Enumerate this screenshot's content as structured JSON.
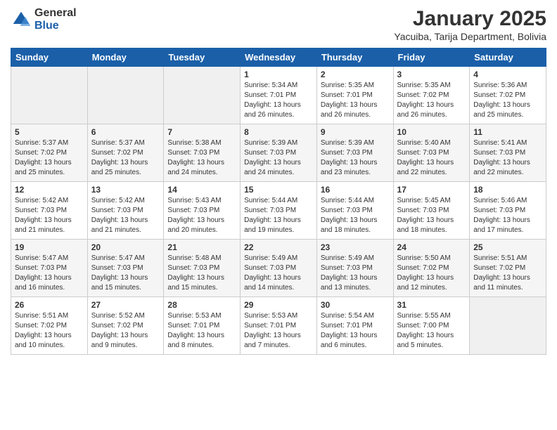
{
  "logo": {
    "general": "General",
    "blue": "Blue"
  },
  "title": "January 2025",
  "subtitle": "Yacuiba, Tarija Department, Bolivia",
  "days_of_week": [
    "Sunday",
    "Monday",
    "Tuesday",
    "Wednesday",
    "Thursday",
    "Friday",
    "Saturday"
  ],
  "weeks": [
    [
      {
        "day": "",
        "info": ""
      },
      {
        "day": "",
        "info": ""
      },
      {
        "day": "",
        "info": ""
      },
      {
        "day": "1",
        "info": "Sunrise: 5:34 AM\nSunset: 7:01 PM\nDaylight: 13 hours\nand 26 minutes."
      },
      {
        "day": "2",
        "info": "Sunrise: 5:35 AM\nSunset: 7:01 PM\nDaylight: 13 hours\nand 26 minutes."
      },
      {
        "day": "3",
        "info": "Sunrise: 5:35 AM\nSunset: 7:02 PM\nDaylight: 13 hours\nand 26 minutes."
      },
      {
        "day": "4",
        "info": "Sunrise: 5:36 AM\nSunset: 7:02 PM\nDaylight: 13 hours\nand 25 minutes."
      }
    ],
    [
      {
        "day": "5",
        "info": "Sunrise: 5:37 AM\nSunset: 7:02 PM\nDaylight: 13 hours\nand 25 minutes."
      },
      {
        "day": "6",
        "info": "Sunrise: 5:37 AM\nSunset: 7:02 PM\nDaylight: 13 hours\nand 25 minutes."
      },
      {
        "day": "7",
        "info": "Sunrise: 5:38 AM\nSunset: 7:03 PM\nDaylight: 13 hours\nand 24 minutes."
      },
      {
        "day": "8",
        "info": "Sunrise: 5:39 AM\nSunset: 7:03 PM\nDaylight: 13 hours\nand 24 minutes."
      },
      {
        "day": "9",
        "info": "Sunrise: 5:39 AM\nSunset: 7:03 PM\nDaylight: 13 hours\nand 23 minutes."
      },
      {
        "day": "10",
        "info": "Sunrise: 5:40 AM\nSunset: 7:03 PM\nDaylight: 13 hours\nand 22 minutes."
      },
      {
        "day": "11",
        "info": "Sunrise: 5:41 AM\nSunset: 7:03 PM\nDaylight: 13 hours\nand 22 minutes."
      }
    ],
    [
      {
        "day": "12",
        "info": "Sunrise: 5:42 AM\nSunset: 7:03 PM\nDaylight: 13 hours\nand 21 minutes."
      },
      {
        "day": "13",
        "info": "Sunrise: 5:42 AM\nSunset: 7:03 PM\nDaylight: 13 hours\nand 21 minutes."
      },
      {
        "day": "14",
        "info": "Sunrise: 5:43 AM\nSunset: 7:03 PM\nDaylight: 13 hours\nand 20 minutes."
      },
      {
        "day": "15",
        "info": "Sunrise: 5:44 AM\nSunset: 7:03 PM\nDaylight: 13 hours\nand 19 minutes."
      },
      {
        "day": "16",
        "info": "Sunrise: 5:44 AM\nSunset: 7:03 PM\nDaylight: 13 hours\nand 18 minutes."
      },
      {
        "day": "17",
        "info": "Sunrise: 5:45 AM\nSunset: 7:03 PM\nDaylight: 13 hours\nand 18 minutes."
      },
      {
        "day": "18",
        "info": "Sunrise: 5:46 AM\nSunset: 7:03 PM\nDaylight: 13 hours\nand 17 minutes."
      }
    ],
    [
      {
        "day": "19",
        "info": "Sunrise: 5:47 AM\nSunset: 7:03 PM\nDaylight: 13 hours\nand 16 minutes."
      },
      {
        "day": "20",
        "info": "Sunrise: 5:47 AM\nSunset: 7:03 PM\nDaylight: 13 hours\nand 15 minutes."
      },
      {
        "day": "21",
        "info": "Sunrise: 5:48 AM\nSunset: 7:03 PM\nDaylight: 13 hours\nand 15 minutes."
      },
      {
        "day": "22",
        "info": "Sunrise: 5:49 AM\nSunset: 7:03 PM\nDaylight: 13 hours\nand 14 minutes."
      },
      {
        "day": "23",
        "info": "Sunrise: 5:49 AM\nSunset: 7:03 PM\nDaylight: 13 hours\nand 13 minutes."
      },
      {
        "day": "24",
        "info": "Sunrise: 5:50 AM\nSunset: 7:02 PM\nDaylight: 13 hours\nand 12 minutes."
      },
      {
        "day": "25",
        "info": "Sunrise: 5:51 AM\nSunset: 7:02 PM\nDaylight: 13 hours\nand 11 minutes."
      }
    ],
    [
      {
        "day": "26",
        "info": "Sunrise: 5:51 AM\nSunset: 7:02 PM\nDaylight: 13 hours\nand 10 minutes."
      },
      {
        "day": "27",
        "info": "Sunrise: 5:52 AM\nSunset: 7:02 PM\nDaylight: 13 hours\nand 9 minutes."
      },
      {
        "day": "28",
        "info": "Sunrise: 5:53 AM\nSunset: 7:01 PM\nDaylight: 13 hours\nand 8 minutes."
      },
      {
        "day": "29",
        "info": "Sunrise: 5:53 AM\nSunset: 7:01 PM\nDaylight: 13 hours\nand 7 minutes."
      },
      {
        "day": "30",
        "info": "Sunrise: 5:54 AM\nSunset: 7:01 PM\nDaylight: 13 hours\nand 6 minutes."
      },
      {
        "day": "31",
        "info": "Sunrise: 5:55 AM\nSunset: 7:00 PM\nDaylight: 13 hours\nand 5 minutes."
      },
      {
        "day": "",
        "info": ""
      }
    ]
  ]
}
